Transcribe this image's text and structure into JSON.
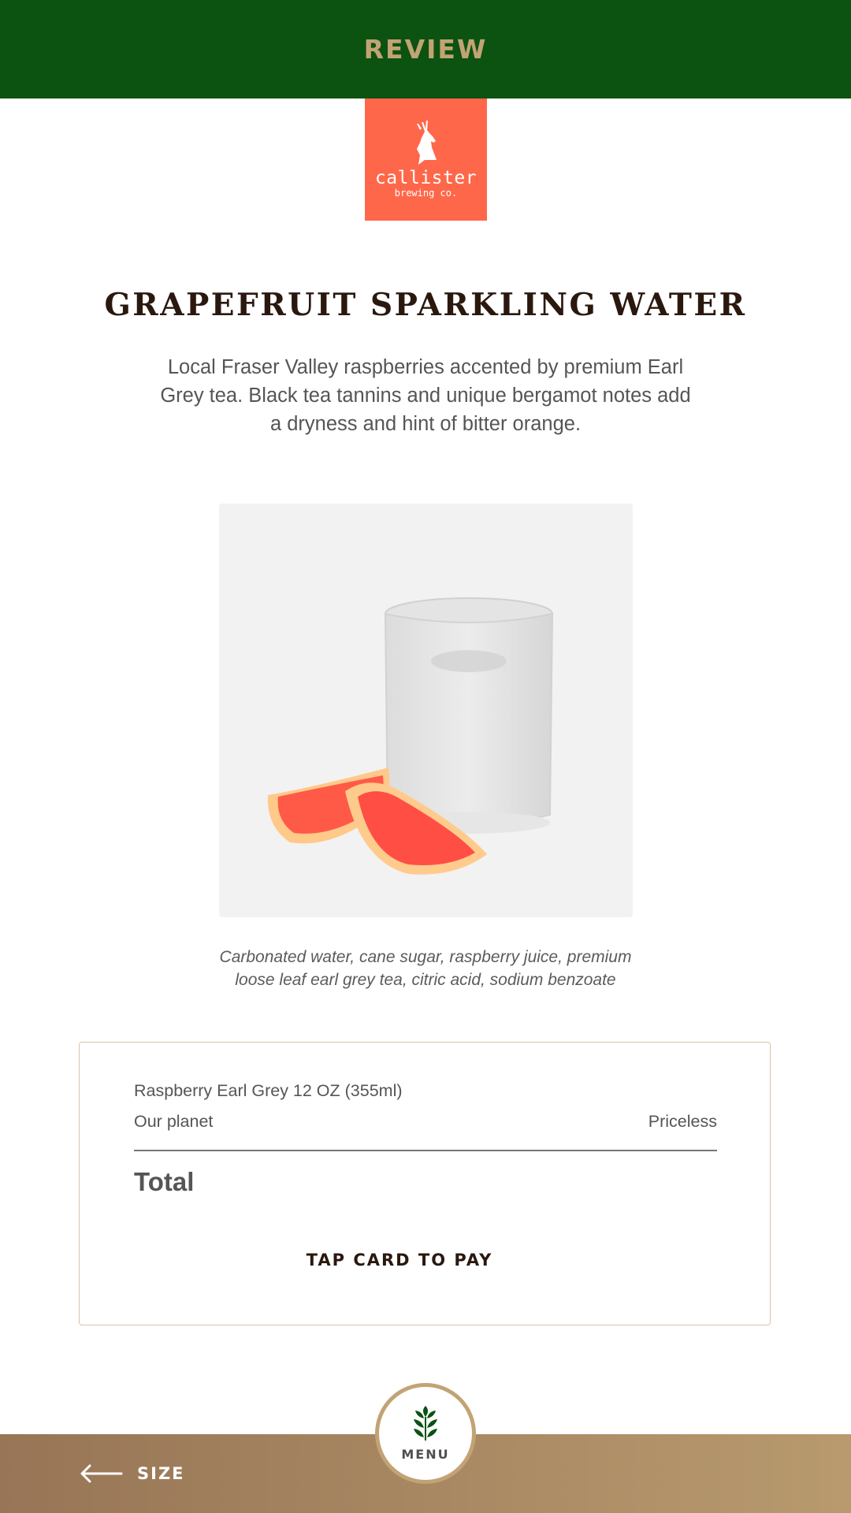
{
  "header": {
    "title": "REVIEW"
  },
  "brand": {
    "name": "callister",
    "tagline": "brewing co.",
    "color": "#ff674a"
  },
  "product": {
    "title": "GRAPEFRUIT SPARKLING WATER",
    "description": "Local Fraser Valley raspberries accented by premium Earl Grey tea. Black tea tannins and unique bergamot notes add a dryness and hint of bitter orange.",
    "ingredients": "Carbonated water, cane sugar, raspberry juice, premium loose leaf earl grey tea, citric acid, sodium benzoate"
  },
  "order": {
    "item": "Raspberry Earl Grey 12 OZ (355ml)",
    "row_label": "Our planet",
    "row_value": "Priceless",
    "total_label": "Total",
    "pay_label": "TAP CARD TO PAY"
  },
  "footer": {
    "back_label": "SIZE",
    "menu_label": "MENU"
  },
  "colors": {
    "header_bg": "#0c5211",
    "accent_gold": "#c2a374",
    "footer_start": "#977556",
    "footer_end": "#b89a6e"
  }
}
